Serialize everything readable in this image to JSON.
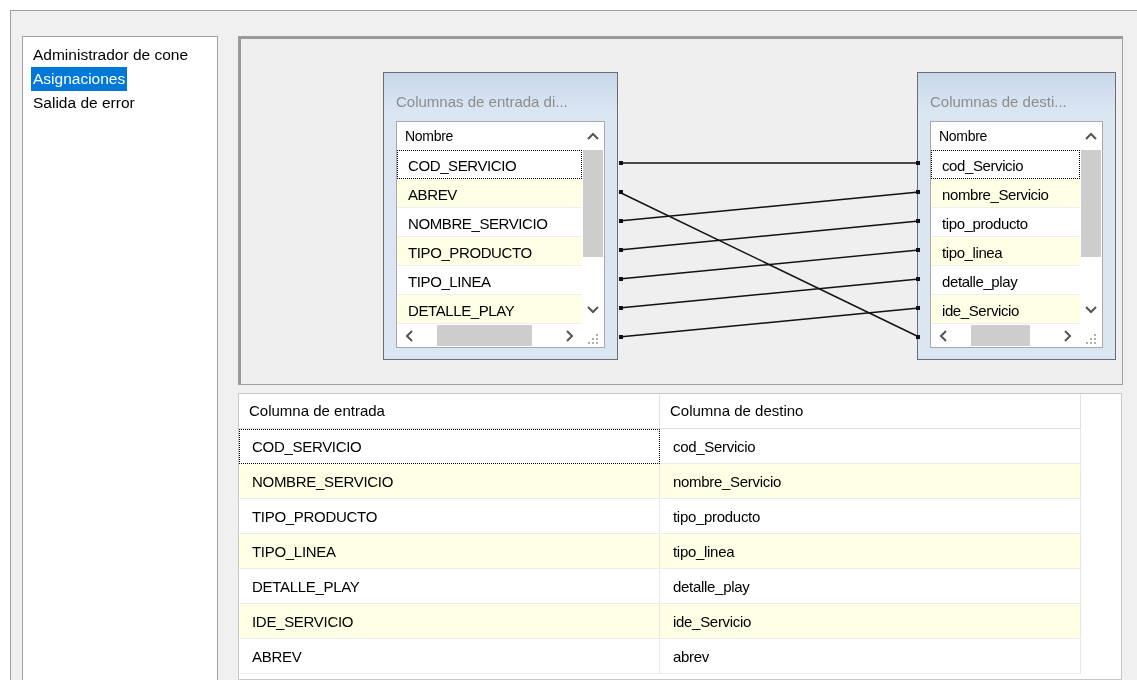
{
  "sidebar": {
    "items": [
      {
        "label": "Administrador de cone",
        "selected": false
      },
      {
        "label": "Asignaciones",
        "selected": true
      },
      {
        "label": "Salida de error",
        "selected": false
      }
    ]
  },
  "diagram": {
    "source": {
      "title": "Columnas de entrada di...",
      "header": "Nombre",
      "rows": [
        {
          "label": "COD_SERVICIO",
          "focused": true
        },
        {
          "label": "ABREV",
          "focused": false
        },
        {
          "label": "NOMBRE_SERVICIO",
          "focused": false
        },
        {
          "label": "TIPO_PRODUCTO",
          "focused": false
        },
        {
          "label": "TIPO_LINEA",
          "focused": false
        },
        {
          "label": "DETALLE_PLAY",
          "focused": false
        }
      ]
    },
    "target": {
      "title": "Columnas de desti...",
      "header": "Nombre",
      "rows": [
        {
          "label": "cod_Servicio",
          "focused": true
        },
        {
          "label": "nombre_Servicio",
          "focused": false
        },
        {
          "label": "tipo_producto",
          "focused": false
        },
        {
          "label": "tipo_linea",
          "focused": false
        },
        {
          "label": "detalle_play",
          "focused": false
        },
        {
          "label": "ide_Servicio",
          "focused": false
        }
      ]
    }
  },
  "table": {
    "columns": [
      "Columna de entrada",
      "Columna de destino"
    ],
    "rows": [
      {
        "cells": [
          "COD_SERVICIO",
          "cod_Servicio"
        ],
        "focused": true
      },
      {
        "cells": [
          "NOMBRE_SERVICIO",
          "nombre_Servicio"
        ],
        "focused": false
      },
      {
        "cells": [
          "TIPO_PRODUCTO",
          "tipo_producto"
        ],
        "focused": false
      },
      {
        "cells": [
          "TIPO_LINEA",
          "tipo_linea"
        ],
        "focused": false
      },
      {
        "cells": [
          "DETALLE_PLAY",
          "detalle_play"
        ],
        "focused": false
      },
      {
        "cells": [
          "IDE_SERVICIO",
          "ide_Servicio"
        ],
        "focused": false
      },
      {
        "cells": [
          "ABREV",
          "abrev"
        ],
        "focused": false
      }
    ]
  }
}
